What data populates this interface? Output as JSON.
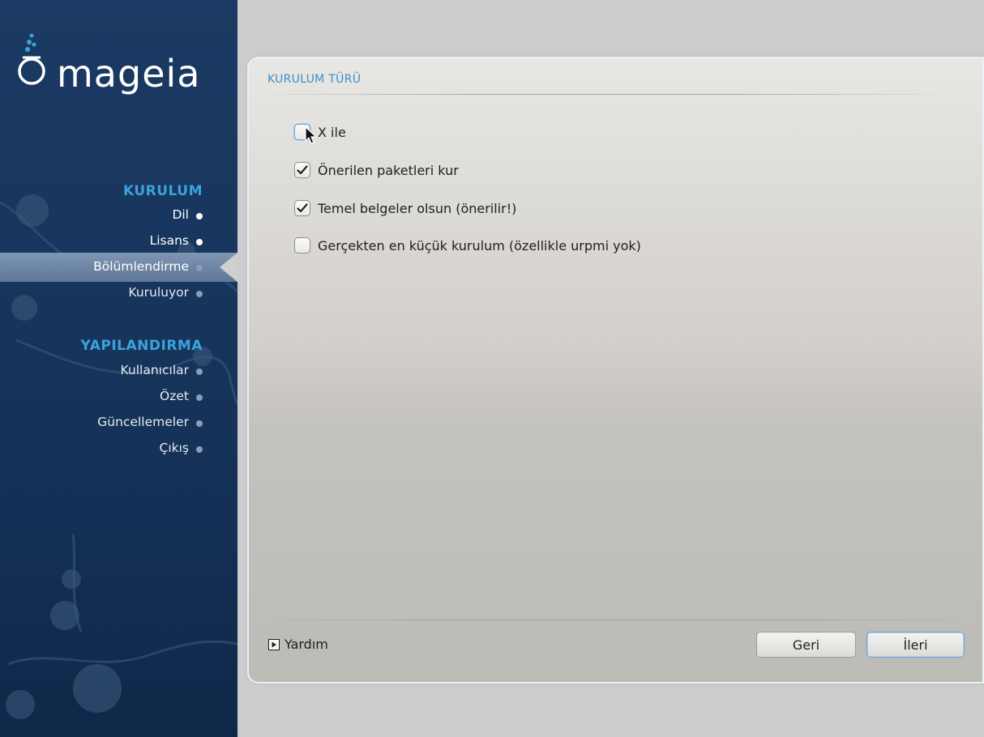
{
  "brand": {
    "name": "mageia"
  },
  "sidebar": {
    "sections": [
      {
        "title": "KURULUM",
        "items": [
          {
            "label": "Dil",
            "state": "done"
          },
          {
            "label": "Lisans",
            "state": "done"
          },
          {
            "label": "Bölümlendirme",
            "state": "current"
          },
          {
            "label": "Kuruluyor",
            "state": "pending"
          }
        ]
      },
      {
        "title": "YAPILANDIRMA",
        "items": [
          {
            "label": "Kullanıcılar",
            "state": "pending"
          },
          {
            "label": "Özet",
            "state": "pending"
          },
          {
            "label": "Güncellemeler",
            "state": "pending"
          },
          {
            "label": "Çıkış",
            "state": "pending"
          }
        ]
      }
    ]
  },
  "main": {
    "title": "KURULUM TÜRÜ",
    "options": [
      {
        "label": "X ile",
        "checked": false,
        "focused": true
      },
      {
        "label": "Önerilen paketleri kur",
        "checked": true
      },
      {
        "label": "Temel belgeler olsun (önerilir!)",
        "checked": true
      },
      {
        "label": "Gerçekten en küçük kurulum (özellikle urpmi yok)",
        "checked": false
      }
    ],
    "help_label": "Yardım",
    "back_label": "Geri",
    "next_label": "İleri"
  },
  "colors": {
    "sidebar_bg": "#17345b",
    "section_title": "#3aa3dc",
    "panel_title": "#3b8fcf",
    "focus_ring": "#6ea4cf"
  },
  "icons": {
    "logo": "mageia-cauldron-icon",
    "help": "triangle-right-icon",
    "check": "checkmark-icon",
    "cursor": "mouse-pointer-icon"
  }
}
